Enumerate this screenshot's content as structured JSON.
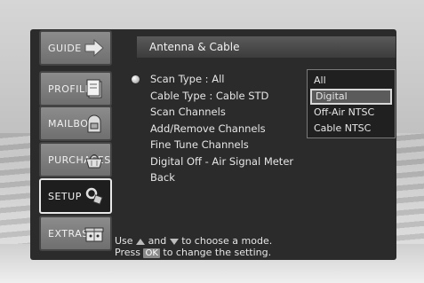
{
  "nav": {
    "items": [
      {
        "label": "GUIDE",
        "icon": "arrow-right-icon",
        "active": false
      },
      {
        "label": "PROFILES",
        "icon": "document-icon",
        "active": false
      },
      {
        "label": "MAILBOX",
        "icon": "mailbox-icon",
        "active": false
      },
      {
        "label": "PURCHASES",
        "icon": "basket-icon",
        "active": false
      },
      {
        "label": "SETUP",
        "icon": "tools-icon",
        "active": true
      },
      {
        "label": "EXTRAS",
        "icon": "gift-icon",
        "active": false
      }
    ]
  },
  "header": {
    "title": "Antenna & Cable"
  },
  "menu": {
    "items": [
      {
        "label": "Scan Type : All",
        "selected": true
      },
      {
        "label": "Cable Type : Cable STD"
      },
      {
        "label": "Scan Channels"
      },
      {
        "label": "Add/Remove Channels"
      },
      {
        "label": "Fine Tune Channels"
      },
      {
        "label": "Digital Off - Air Signal Meter"
      },
      {
        "label": "Back"
      }
    ]
  },
  "dropdown": {
    "options": [
      "All",
      "Digital",
      "Off-Air NTSC",
      "Cable NTSC"
    ],
    "highlighted": "Digital"
  },
  "help": {
    "line1_prefix": "Use",
    "line1_and": "and",
    "line1_suffix": "to choose a mode.",
    "line2_prefix": "Press",
    "ok_label": "OK",
    "line2_suffix": "to change the setting."
  }
}
